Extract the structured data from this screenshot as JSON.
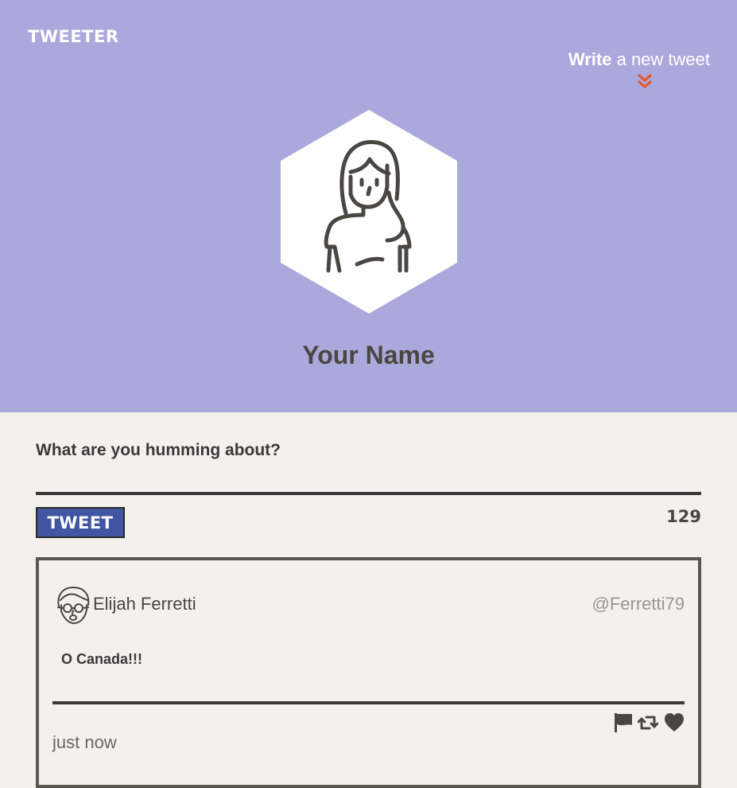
{
  "header": {
    "logo": "TWEETER",
    "compose_toggle": {
      "strong": "Write",
      "light": " a new tweet"
    },
    "arrow_icon": "double-chevron-down-icon",
    "profile": {
      "avatar_icon": "woman-avatar-icon",
      "name": "Your Name"
    },
    "background_color": "#aba8dc"
  },
  "compose": {
    "label": "What are you humming about?",
    "textarea_value": "",
    "button_label": "TWEET",
    "counter": "129",
    "button_color": "#4056a3",
    "arrow_color": "#e8542b"
  },
  "tweets": [
    {
      "avatar_icon": "man-with-glasses-avatar-icon",
      "author": "Elijah Ferretti",
      "handle": "@Ferretti79",
      "content": "O Canada!!!",
      "timestamp": "just now",
      "actions": [
        {
          "icon": "flag-icon"
        },
        {
          "icon": "retweet-icon"
        },
        {
          "icon": "heart-icon"
        }
      ]
    }
  ]
}
